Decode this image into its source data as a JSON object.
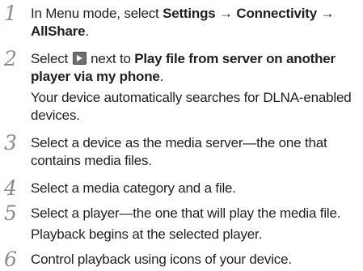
{
  "steps": [
    {
      "number": "1",
      "text_a": "In Menu mode, select ",
      "bold_a": "Settings",
      "text_b": " → ",
      "bold_b": "Connectivity",
      "text_c": " → ",
      "bold_c": "AllShare",
      "text_d": "."
    },
    {
      "number": "2",
      "text_a": "Select ",
      "icon": "next-arrow-icon",
      "text_b": " next to ",
      "bold_a": "Play file from server on another player via my phone",
      "text_c": ".",
      "sub": "Your device automatically searches for DLNA-enabled devices."
    },
    {
      "number": "3",
      "text": "Select a device as the media server—the one that contains media files."
    },
    {
      "number": "4",
      "text": "Select a media category and a file."
    },
    {
      "number": "5",
      "text": "Select a player—the one that will play the media file.",
      "sub": "Playback begins at the selected player."
    },
    {
      "number": "6",
      "text": "Control playback using icons of your device."
    }
  ],
  "colors": {
    "text": "#231f20",
    "step_number": "#8a8a8a",
    "icon_fill": "#6f6f6f"
  }
}
